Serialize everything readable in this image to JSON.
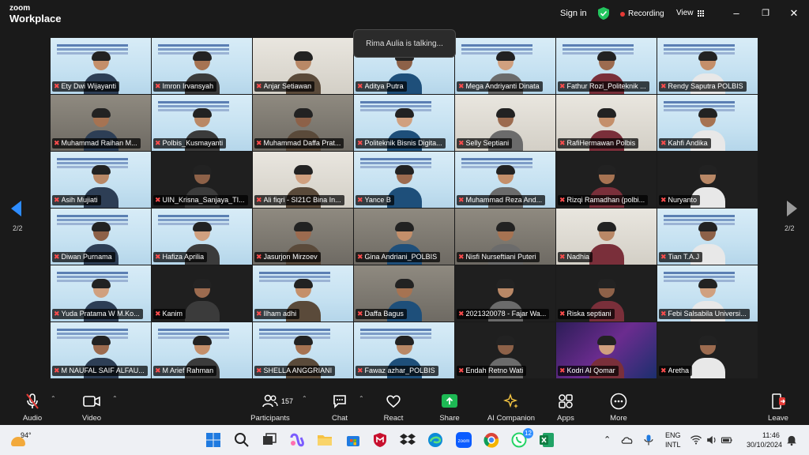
{
  "app": {
    "brand_top": "zoom",
    "brand_bottom": "Workplace"
  },
  "header": {
    "signin": "Sign in",
    "recording": "Recording",
    "view": "View"
  },
  "talking": "Rima Aulia is talking...",
  "pagination": {
    "left": "2/2",
    "right": "2/2"
  },
  "participants": [
    "Ety Dwi Wijayanti",
    "Imron Irvansyah",
    "Anjar Setiawan",
    "Aditya Putra",
    "Mega Andriyanti Dinata",
    "Fathur Rozi_Politeknik ...",
    "Rendy Saputra POLBIS",
    "Muhammad Raihan M...",
    "Polbis_Kusmayanti",
    "Muhammad Daffa Prat...",
    "Politeknik Bisnis Digita...",
    "Selly Septiani",
    "RafiHermawan Polbis",
    "Kahfi Andika",
    "Asih Mujiati",
    "UIN_Krisna_Sanjaya_TI...",
    "Ali fiqri - SI21C Bina In...",
    "Yance B",
    "Muhammad Reza And...",
    "Rizqi Ramadhan (polbi...",
    "Nuryanto",
    "Diwan Purnama",
    "Hafiza Aprilia",
    "Jasurjon Mirzoev",
    "Gina Andriani_POLBIS",
    "Nisfi Nurseftiani Puteri",
    "Nadhia",
    "Tian T.A.J",
    "Yuda Pratama W M.Ko...",
    "Kanim",
    "Ilham adhi",
    "Daffa Bagus",
    "2021320078 - Fajar Wa...",
    "Riska septiani",
    "Febi Salsabila Universi...",
    "M NAUFAL SAIF ALFAU...",
    "M Arief Rahman",
    "SHELLA ANGGRIANI",
    "Fawaz azhar_POLBIS",
    "Endah Retno Wati",
    "Kodri Al Qomar",
    "Aretha"
  ],
  "toolbar": {
    "audio": "Audio",
    "video": "Video",
    "participants": "Participants",
    "participants_count": "157",
    "chat": "Chat",
    "react": "React",
    "share": "Share",
    "ai": "AI Companion",
    "apps": "Apps",
    "more": "More",
    "leave": "Leave"
  },
  "taskbar": {
    "temp": "94°",
    "lang1": "ENG",
    "lang2": "INTL",
    "time": "11:46",
    "date": "30/10/2024",
    "badge": "12"
  },
  "colors": {
    "accent": "#2d8cff",
    "share": "#1db954",
    "mute": "#ff4d4d",
    "leave": "#e53935"
  }
}
